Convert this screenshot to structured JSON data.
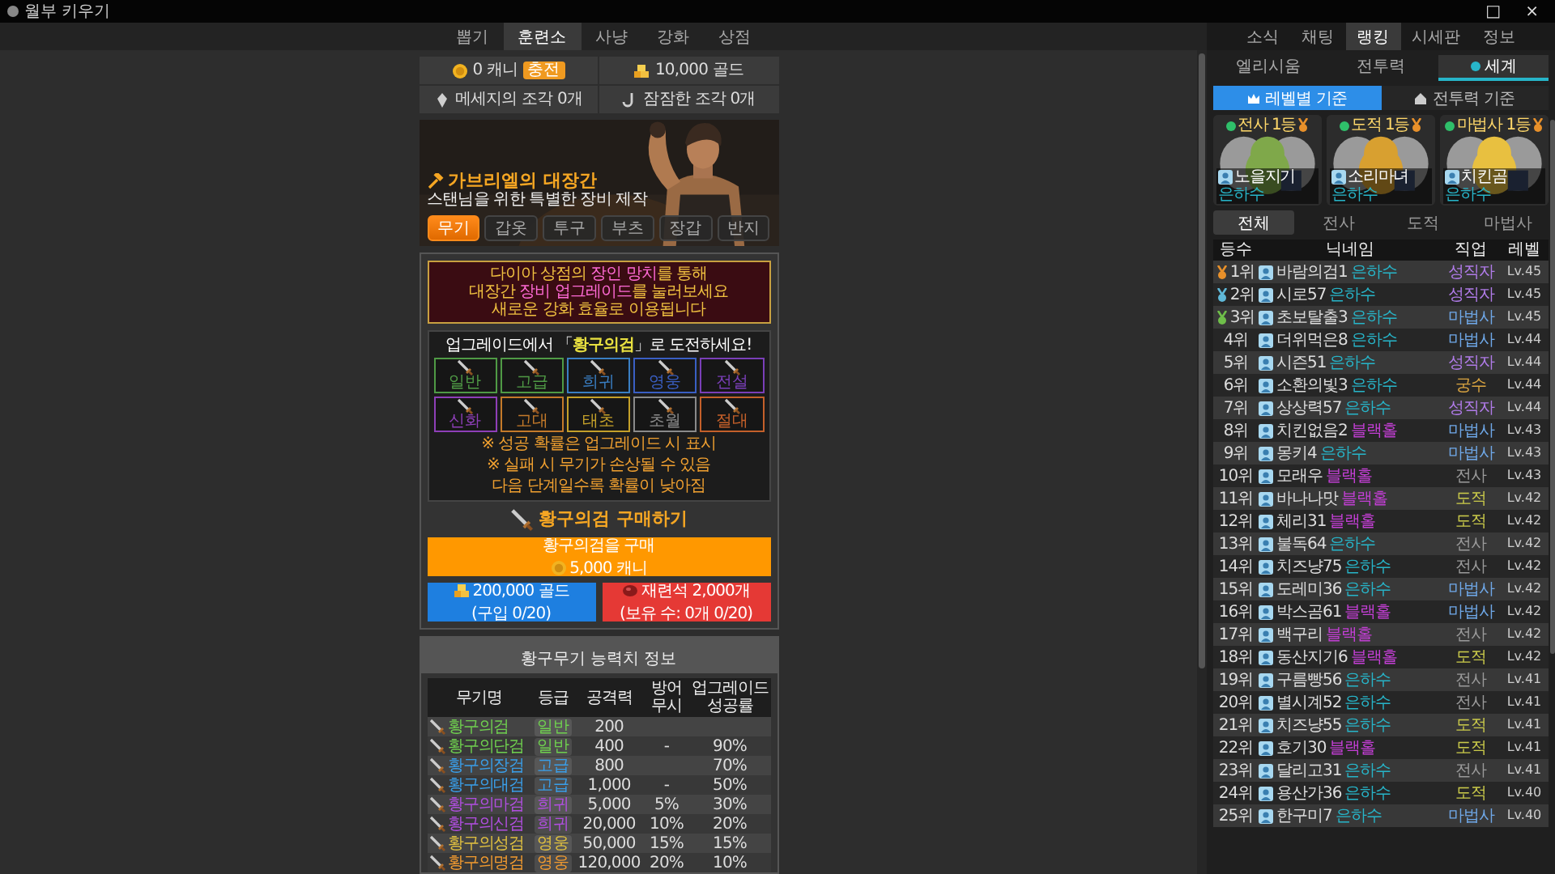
{
  "window": {
    "title": "월부 키우기",
    "controls": [
      "□",
      "×"
    ]
  },
  "main_tabs": [
    {
      "label": "뽑기",
      "selected": false
    },
    {
      "label": "훈련소",
      "selected": true
    },
    {
      "label": "사냥",
      "selected": false
    },
    {
      "label": "강화",
      "selected": false
    },
    {
      "label": "상점",
      "selected": false
    }
  ],
  "resources": [
    {
      "kind": "coin",
      "label": "0 캐니",
      "badge": "충전"
    },
    {
      "kind": "gold",
      "label": "10,000 골드"
    },
    {
      "kind": "shard",
      "label": "메세지의 조각 0개"
    },
    {
      "kind": "hook",
      "label": "잠잠한 조각 0개"
    }
  ],
  "forge": {
    "title": "가브리엘의 대장간",
    "subtitle": "스탠님을 위한 특별한 장비 제작",
    "tabs": [
      {
        "label": "무기",
        "selected": true
      },
      {
        "label": "갑옷",
        "selected": false
      },
      {
        "label": "투구",
        "selected": false
      },
      {
        "label": "부츠",
        "selected": false
      },
      {
        "label": "장갑",
        "selected": false
      },
      {
        "label": "반지",
        "selected": false
      }
    ],
    "notice": [
      "다이아 상점의 **장인 망치**를 통해",
      "대장간 **장비 업그레이드**를 눌러보세요",
      "새로운 강화 효율로 이용됩니다"
    ],
    "upgrade_panel": {
      "title": "업그레이드에서 「**황구의검**」로 도전하세요!",
      "slots": [
        {
          "label": "일반",
          "color": "#4f9a45"
        },
        {
          "label": "고급",
          "color": "#4f9a45"
        },
        {
          "label": "희귀",
          "color": "#3a7fc4"
        },
        {
          "label": "영웅",
          "color": "#3a5fc4"
        },
        {
          "label": "전설",
          "color": "#7a3fb8"
        },
        {
          "label": "신화",
          "color": "#8e3fb8"
        },
        {
          "label": "고대",
          "color": "#c47a2a"
        },
        {
          "label": "태초",
          "color": "#c4a02a"
        },
        {
          "label": "초월",
          "color": "#8a8a8a"
        },
        {
          "label": "절대",
          "color": "#c4602a"
        }
      ],
      "notes": [
        "※ 성공 확률은 업그레이드 시 표시",
        "※ 실패 시 무기가 손상될 수 있음",
        "다음 단계일수록 확률이 낮아짐"
      ]
    },
    "buy": {
      "title": "황구의검 구매하기",
      "primary": {
        "label": "황구의검을 구매",
        "price": "5,000 캐니"
      },
      "gold": {
        "label": "200,000 골드",
        "limit": "(구입 0/20)"
      },
      "stone": {
        "label": "재련석 2,000개",
        "limit": "(보유 수: 0개 0/20)"
      }
    }
  },
  "weapon_table": {
    "title": "황구무기 능력치 정보",
    "columns": [
      "무기명",
      "등급",
      "공격력",
      "방어 무시",
      "업그레이드 성공률"
    ],
    "rows": [
      {
        "name": "황구의검",
        "grade": "일반",
        "attack": "200",
        "color": "#6fcf4f"
      },
      {
        "name": "황구의단검",
        "grade": "일반",
        "attack": "400",
        "ignore": "-",
        "rate": "90%",
        "color": "#6fcf4f"
      },
      {
        "name": "황구의장검",
        "grade": "고급",
        "attack": "800",
        "rate": "70%",
        "color": "#3a9ee8"
      },
      {
        "name": "황구의대검",
        "grade": "고급",
        "attack": "1,000",
        "ignore": "-",
        "rate": "50%",
        "color": "#3a9ee8"
      },
      {
        "name": "황구의마검",
        "grade": "희귀",
        "attack": "5,000",
        "ignore": "5%",
        "rate": "30%",
        "color": "#b14fe0"
      },
      {
        "name": "황구의신검",
        "grade": "희귀",
        "attack": "20,000",
        "ignore": "10%",
        "rate": "20%",
        "color": "#b14fe0"
      },
      {
        "name": "황구의성검",
        "grade": "영웅",
        "attack": "50,000",
        "ignore": "15%",
        "rate": "15%",
        "color": "#e0c040"
      },
      {
        "name": "황구의명검",
        "grade": "영웅",
        "attack": "120,000",
        "ignore": "20%",
        "rate": "10%",
        "color": "#f09a30"
      }
    ]
  },
  "side_tabs": [
    {
      "label": "소식",
      "selected": false
    },
    {
      "label": "채팅",
      "selected": false
    },
    {
      "label": "랭킹",
      "selected": true
    },
    {
      "label": "시세판",
      "selected": false
    },
    {
      "label": "정보",
      "selected": false
    }
  ],
  "ranking": {
    "scopes": [
      {
        "label": "엘리시움",
        "selected": false
      },
      {
        "label": "전투력",
        "selected": false
      },
      {
        "label": "세계",
        "selected": true
      }
    ],
    "bases": [
      {
        "kind": "level",
        "label": "레벨별 기준",
        "selected": true
      },
      {
        "kind": "power",
        "label": "전투력 기준",
        "selected": false
      }
    ],
    "leaders": [
      {
        "title": "전사 1등",
        "name": "노을지기",
        "guild": "은하수"
      },
      {
        "title": "도적 1등",
        "name": "소리마녀",
        "guild": "은하수"
      },
      {
        "title": "마법사 1등",
        "name": "치킨곰",
        "guild": "은하수"
      }
    ],
    "filters": [
      {
        "label": "전체",
        "selected": true
      },
      {
        "label": "전사",
        "selected": false
      },
      {
        "label": "도적",
        "selected": false
      },
      {
        "label": "마법사",
        "selected": false
      }
    ],
    "columns": [
      "등수",
      "닉네임",
      "직업",
      "레벨"
    ],
    "rows": [
      {
        "rank": "1위",
        "medal": {
          "color": "#e8902a"
        },
        "name": "바람의검1",
        "guild": {
          "label": "은하수",
          "color": "#27b5c9"
        },
        "job": {
          "label": "성직자",
          "color": "#b07be8"
        },
        "level": "Lv.45"
      },
      {
        "rank": "2위",
        "medal": {
          "color": "#5fb8d8"
        },
        "name": "시로57",
        "guild": {
          "label": "은하수",
          "color": "#27b5c9"
        },
        "job": {
          "label": "성직자",
          "color": "#b07be8"
        },
        "level": "Lv.45"
      },
      {
        "rank": "3위",
        "medal": {
          "color": "#6fbf4a"
        },
        "name": "초보탈출3",
        "guild": {
          "label": "은하수",
          "color": "#27b5c9"
        },
        "job": {
          "label": "마법사",
          "color": "#6fa8e8"
        },
        "level": "Lv.45"
      },
      {
        "rank": "4위",
        "name": "더위먹은8",
        "guild": {
          "label": "은하수",
          "color": "#27b5c9"
        },
        "job": {
          "label": "마법사",
          "color": "#6fa8e8"
        },
        "level": "Lv.44"
      },
      {
        "rank": "5위",
        "name": "시즌51",
        "guild": {
          "label": "은하수",
          "color": "#27b5c9"
        },
        "job": {
          "label": "성직자",
          "color": "#b07be8"
        },
        "level": "Lv.44"
      },
      {
        "rank": "6위",
        "name": "소환의빛3",
        "guild": {
          "label": "은하수",
          "color": "#27b5c9"
        },
        "job": {
          "label": "궁수",
          "color": "#d9a441"
        },
        "level": "Lv.44"
      },
      {
        "rank": "7위",
        "name": "상상력57",
        "guild": {
          "label": "은하수",
          "color": "#27b5c9"
        },
        "job": {
          "label": "성직자",
          "color": "#b07be8"
        },
        "level": "Lv.44"
      },
      {
        "rank": "8위",
        "name": "치킨없음2",
        "guild": {
          "label": "블랙홀",
          "color": "#c43fd6"
        },
        "job": {
          "label": "마법사",
          "color": "#6fa8e8"
        },
        "level": "Lv.43"
      },
      {
        "rank": "9위",
        "name": "몽키4",
        "guild": {
          "label": "은하수",
          "color": "#27b5c9"
        },
        "job": {
          "label": "마법사",
          "color": "#6fa8e8"
        },
        "level": "Lv.43"
      },
      {
        "rank": "10위",
        "name": "모래우",
        "guild": {
          "label": "블랙홀",
          "color": "#c43fd6"
        },
        "job": {
          "label": "전사",
          "color": "#9a9a9a"
        },
        "level": "Lv.43"
      },
      {
        "rank": "11위",
        "name": "바나나맛",
        "guild": {
          "label": "블랙홀",
          "color": "#c43fd6"
        },
        "job": {
          "label": "도적",
          "color": "#c9c94a"
        },
        "level": "Lv.42"
      },
      {
        "rank": "12위",
        "name": "체리31",
        "guild": {
          "label": "블랙홀",
          "color": "#c43fd6"
        },
        "job": {
          "label": "도적",
          "color": "#c9c94a"
        },
        "level": "Lv.42"
      },
      {
        "rank": "13위",
        "name": "불독64",
        "guild": {
          "label": "은하수",
          "color": "#27b5c9"
        },
        "job": {
          "label": "전사",
          "color": "#9a9a9a"
        },
        "level": "Lv.42"
      },
      {
        "rank": "14위",
        "name": "치즈냥75",
        "guild": {
          "label": "은하수",
          "color": "#27b5c9"
        },
        "job": {
          "label": "전사",
          "color": "#9a9a9a"
        },
        "level": "Lv.42"
      },
      {
        "rank": "15위",
        "name": "도레미36",
        "guild": {
          "label": "은하수",
          "color": "#27b5c9"
        },
        "job": {
          "label": "마법사",
          "color": "#6fa8e8"
        },
        "level": "Lv.42"
      },
      {
        "rank": "16위",
        "name": "박스곰61",
        "guild": {
          "label": "블랙홀",
          "color": "#c43fd6"
        },
        "job": {
          "label": "마법사",
          "color": "#6fa8e8"
        },
        "level": "Lv.42"
      },
      {
        "rank": "17위",
        "name": "백구리",
        "guild": {
          "label": "블랙홀",
          "color": "#c43fd6"
        },
        "job": {
          "label": "전사",
          "color": "#9a9a9a"
        },
        "level": "Lv.42"
      },
      {
        "rank": "18위",
        "name": "동산지기6",
        "guild": {
          "label": "블랙홀",
          "color": "#c43fd6"
        },
        "job": {
          "label": "도적",
          "color": "#c9c94a"
        },
        "level": "Lv.42"
      },
      {
        "rank": "19위",
        "name": "구름빵56",
        "guild": {
          "label": "은하수",
          "color": "#27b5c9"
        },
        "job": {
          "label": "전사",
          "color": "#9a9a9a"
        },
        "level": "Lv.41"
      },
      {
        "rank": "20위",
        "name": "별시계52",
        "guild": {
          "label": "은하수",
          "color": "#27b5c9"
        },
        "job": {
          "label": "전사",
          "color": "#9a9a9a"
        },
        "level": "Lv.41"
      },
      {
        "rank": "21위",
        "name": "치즈냥55",
        "guild": {
          "label": "은하수",
          "color": "#27b5c9"
        },
        "job": {
          "label": "도적",
          "color": "#c9c94a"
        },
        "level": "Lv.41"
      },
      {
        "rank": "22위",
        "name": "호기30",
        "guild": {
          "label": "블랙홀",
          "color": "#c43fd6"
        },
        "job": {
          "label": "도적",
          "color": "#c9c94a"
        },
        "level": "Lv.41"
      },
      {
        "rank": "23위",
        "name": "달리고31",
        "guild": {
          "label": "은하수",
          "color": "#27b5c9"
        },
        "job": {
          "label": "전사",
          "color": "#9a9a9a"
        },
        "level": "Lv.41"
      },
      {
        "rank": "24위",
        "name": "용산가36",
        "guild": {
          "label": "은하수",
          "color": "#27b5c9"
        },
        "job": {
          "label": "도적",
          "color": "#c9c94a"
        },
        "level": "Lv.40"
      },
      {
        "rank": "25위",
        "name": "한구미7",
        "guild": {
          "label": "은하수",
          "color": "#27b5c9"
        },
        "job": {
          "label": "마법사",
          "color": "#6fa8e8"
        },
        "level": "Lv.40"
      }
    ]
  }
}
